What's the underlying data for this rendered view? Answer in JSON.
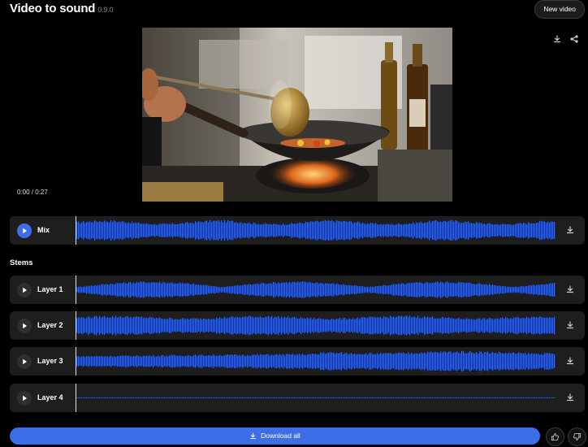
{
  "header": {
    "title": "Video to sound",
    "version": "0.9.0",
    "new_video_label": "New video"
  },
  "player": {
    "time": "0:00 / 0:27"
  },
  "tracks": {
    "mix": {
      "label": "Mix"
    },
    "stems_title": "Stems",
    "stems": [
      {
        "label": "Layer 1"
      },
      {
        "label": "Layer 2"
      },
      {
        "label": "Layer 3"
      },
      {
        "label": "Layer 4"
      }
    ]
  },
  "footer": {
    "download_all_label": "Download all"
  },
  "colors": {
    "accent": "#3b6ee8",
    "wave": "#3a6ae6",
    "track_bg": "#1e1e1e"
  },
  "icons": [
    "download-icon",
    "share-icon",
    "play-icon",
    "thumbs-up-icon",
    "thumbs-down-icon"
  ]
}
